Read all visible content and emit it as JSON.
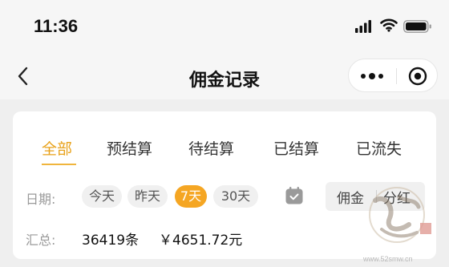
{
  "status_bar": {
    "time": "11:36"
  },
  "nav": {
    "title": "佣金记录"
  },
  "tabs": [
    {
      "label": "全部",
      "active": true
    },
    {
      "label": "预结算",
      "active": false
    },
    {
      "label": "待结算",
      "active": false
    },
    {
      "label": "已结算",
      "active": false
    },
    {
      "label": "已流失",
      "active": false
    }
  ],
  "date_filter": {
    "label": "日期:",
    "options": [
      {
        "label": "今天",
        "active": false
      },
      {
        "label": "昨天",
        "active": false
      },
      {
        "label": "7天",
        "active": true
      },
      {
        "label": "30天",
        "active": false
      }
    ]
  },
  "type_toggle": {
    "options": [
      "佣金",
      "分红"
    ]
  },
  "summary": {
    "label": "汇总:",
    "count": "36419条",
    "amount": "￥4651.72元"
  },
  "watermark": {
    "url": "www.52smw.cn"
  },
  "colors": {
    "accent": "#f5a623",
    "accent_text": "#e8a21b",
    "background": "#efefef",
    "card": "#ffffff"
  }
}
